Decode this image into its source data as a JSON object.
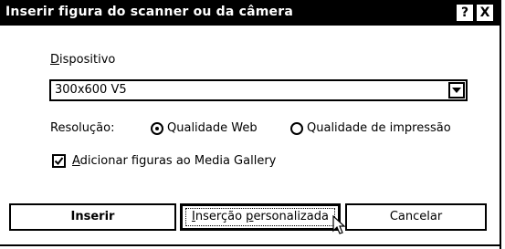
{
  "dialog": {
    "title": "Inserir figura do scanner ou da câmera",
    "help_glyph": "?",
    "close_glyph": "X"
  },
  "device": {
    "label_first": "D",
    "label_rest": "ispositivo",
    "selected": "300x600 V5"
  },
  "resolution": {
    "label": "Resolução:",
    "options": [
      {
        "label": "Qualidade Web",
        "selected": true
      },
      {
        "label": "Qualidade de impressão",
        "selected": false
      }
    ]
  },
  "media_gallery": {
    "label_first": "A",
    "label_rest": "dicionar figuras ao Media Gallery",
    "checked": true
  },
  "buttons": {
    "insert": "Inserir",
    "custom_insert_pre": "I",
    "custom_insert_mid": "nserção ",
    "custom_insert_ul": "p",
    "custom_insert_post": "ersonalizada",
    "cancel": "Cancelar"
  },
  "colors": {
    "titlebar": "#000000",
    "title_text": "#ffffff",
    "background": "#ffffff"
  }
}
